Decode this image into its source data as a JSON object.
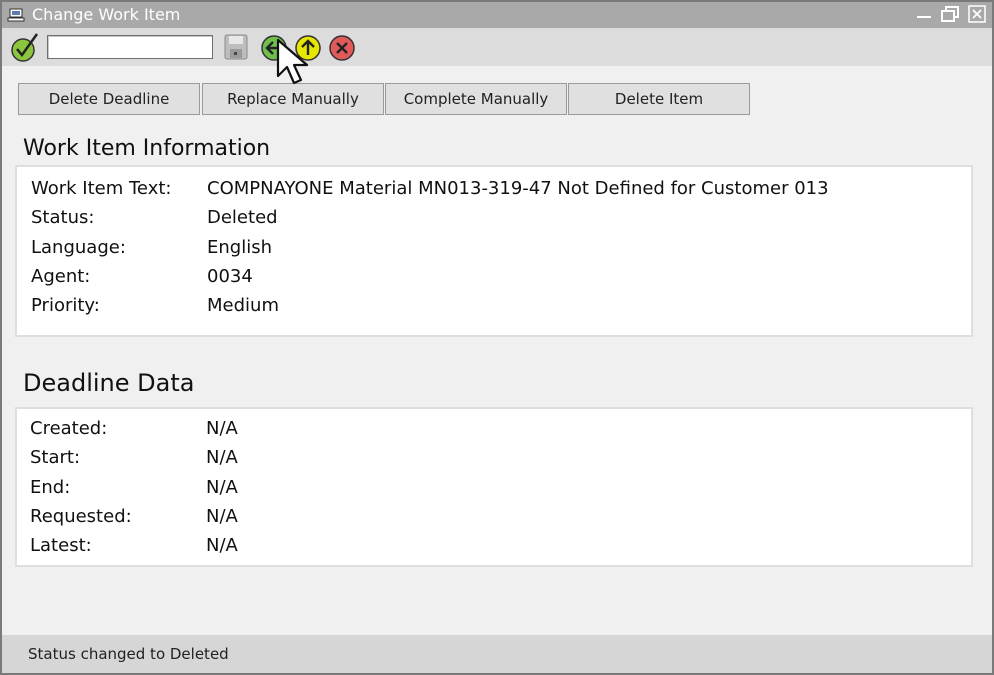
{
  "window": {
    "title": "Change Work Item"
  },
  "toolbar": {
    "command_field_value": ""
  },
  "actions": {
    "delete_deadline": "Delete Deadline",
    "replace_manually": "Replace Manually",
    "complete_manually": "Complete Manually",
    "delete_item": "Delete Item"
  },
  "work_item": {
    "heading": "Work Item Information",
    "fields": [
      {
        "label": "Work Item Text:",
        "value": "COMPNAYONE Material MN013-319-47 Not Defined for Customer 013"
      },
      {
        "label": "Status:",
        "value": "Deleted"
      },
      {
        "label": "Language:",
        "value": "English"
      },
      {
        "label": "Agent:",
        "value": "0034"
      },
      {
        "label": "Priority:",
        "value": "Medium"
      }
    ]
  },
  "deadline": {
    "heading": "Deadline Data",
    "fields": [
      {
        "label": "Created:",
        "value": "N/A"
      },
      {
        "label": "Start:",
        "value": "N/A"
      },
      {
        "label": "End:",
        "value": "N/A"
      },
      {
        "label": "Requested:",
        "value": "N/A"
      },
      {
        "label": "Latest:",
        "value": "N/A"
      }
    ]
  },
  "status_bar": {
    "message": "Status changed to Deleted"
  },
  "icons": {
    "app": "computer-icon",
    "confirm": "checkmark-icon",
    "save": "floppy-disk-icon",
    "back": "back-arrow-icon",
    "up": "up-arrow-icon",
    "cancel": "cancel-x-icon",
    "minimize": "minimize-icon",
    "restore": "restore-icon",
    "close": "close-icon"
  },
  "colors": {
    "titlebar": "#a9a9a9",
    "toolbar": "#dcdcdc",
    "statusbar": "#d6d6d6",
    "confirm_green": "#8cc63f",
    "back_green": "#6fbf4b",
    "up_yellow": "#e6e600",
    "cancel_red": "#e05a5a"
  }
}
